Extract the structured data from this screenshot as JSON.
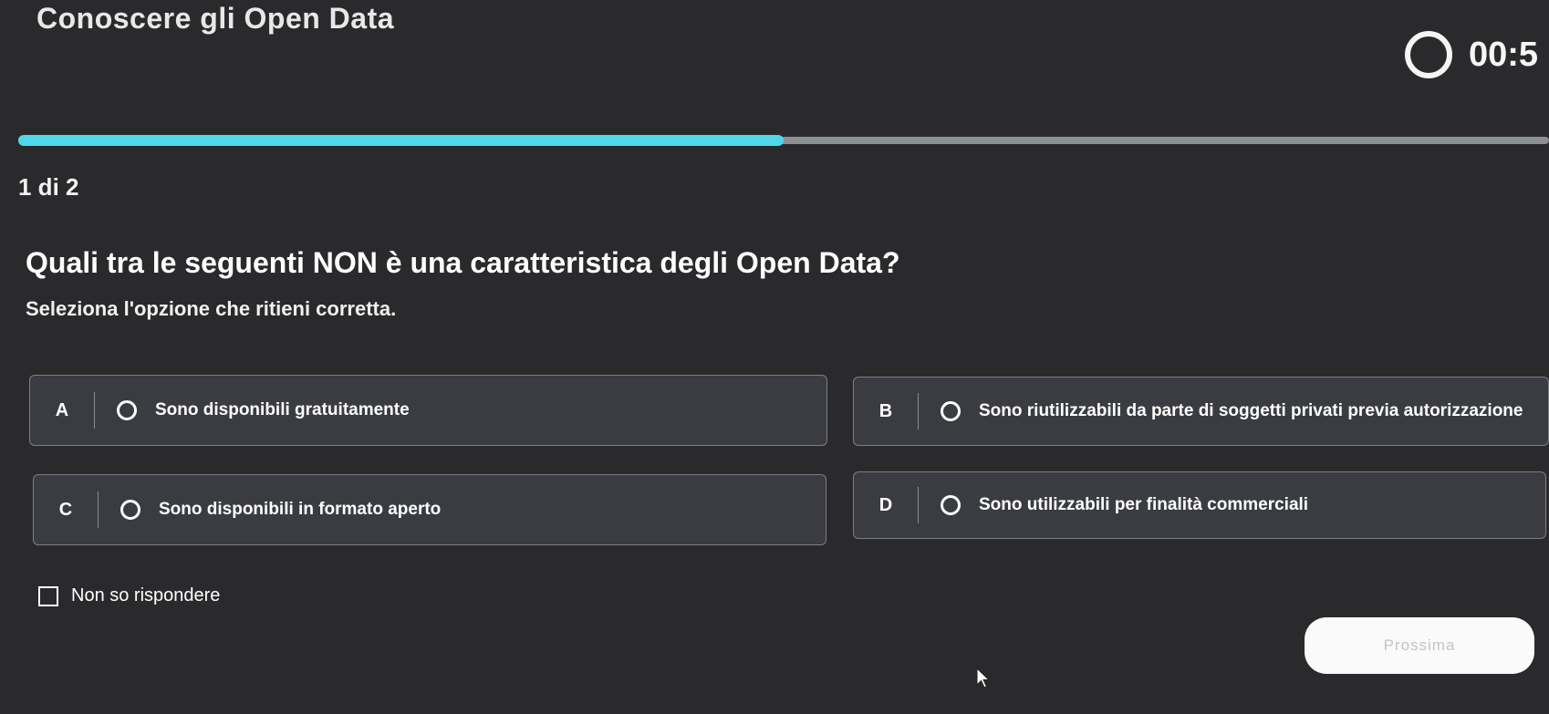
{
  "header": {
    "title": "Conoscere gli Open Data",
    "timer": "00:5"
  },
  "progress": {
    "fraction": 0.5,
    "step_label": "1 di 2"
  },
  "quiz": {
    "question": "Quali tra le seguenti NON è una caratteristica degli Open Data?",
    "instruction": "Seleziona l'opzione che ritieni corretta.",
    "options": [
      {
        "letter": "A",
        "label": "Sono disponibili gratuitamente"
      },
      {
        "letter": "B",
        "label": "Sono riutilizzabili da parte di soggetti privati previa autorizzazione"
      },
      {
        "letter": "C",
        "label": "Sono disponibili in formato aperto"
      },
      {
        "letter": "D",
        "label": "Sono utilizzabili per finalità commerciali"
      }
    ],
    "no_answer_label": "Non so rispondere",
    "next_label": "Prossima"
  },
  "colors": {
    "background": "#2a2a2d",
    "progress_fill": "#4fd8ea",
    "progress_track": "#8d9093",
    "option_bg": "#3a3c42"
  },
  "icons": {
    "timer": "timer-ring-icon",
    "radio": "radio-unchecked-icon",
    "checkbox": "checkbox-unchecked-icon",
    "cursor": "mouse-pointer-icon"
  }
}
